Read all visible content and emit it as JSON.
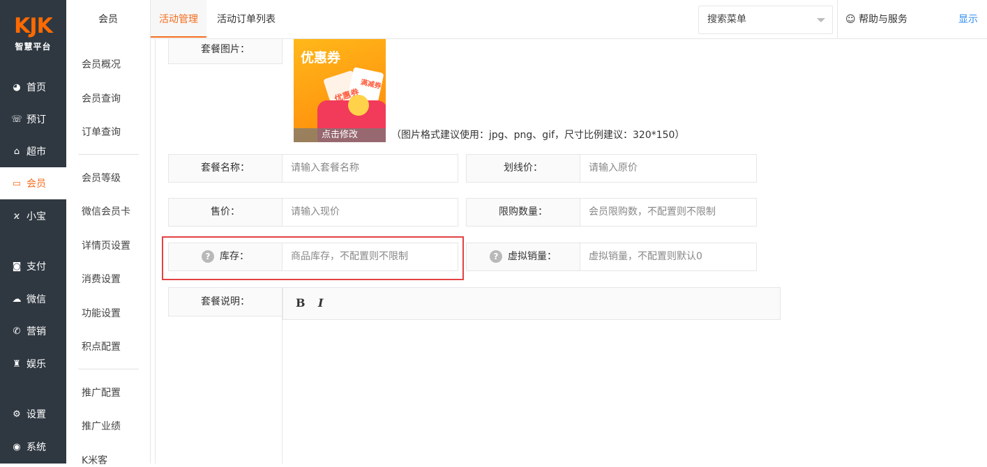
{
  "logo": {
    "mark": "KJK",
    "subtitle": "智慧平台"
  },
  "leftnav": [
    {
      "label": "首页",
      "icon": "dashboard-icon",
      "glyph": "◕"
    },
    {
      "label": "预订",
      "icon": "phone-icon",
      "glyph": "☏"
    },
    {
      "label": "超市",
      "icon": "basket-icon",
      "glyph": "⌂"
    },
    {
      "label": "会员",
      "icon": "card-icon",
      "glyph": "▭"
    },
    {
      "label": "小宝",
      "icon": "xiaobao-icon",
      "glyph": "ϰ"
    },
    {
      "label": "支付",
      "icon": "money-icon",
      "glyph": "◙"
    },
    {
      "label": "微信",
      "icon": "wechat-icon",
      "glyph": "☁"
    },
    {
      "label": "营销",
      "icon": "megaphone-icon",
      "glyph": "✆"
    },
    {
      "label": "娱乐",
      "icon": "game-icon",
      "glyph": "♜"
    },
    {
      "label": "设置",
      "icon": "gear-icon",
      "glyph": "⚙"
    },
    {
      "label": "系统",
      "icon": "chrome-icon",
      "glyph": "◉"
    }
  ],
  "subnav": {
    "head": "会员",
    "items": [
      "会员概况",
      "会员查询",
      "订单查询",
      "会员等级",
      "微信会员卡",
      "详情页设置",
      "消费设置",
      "功能设置",
      "积点配置",
      "推广配置",
      "推广业绩",
      "K米客"
    ]
  },
  "topbar": {
    "tabs": [
      "活动管理",
      "活动订单列表"
    ],
    "search_menu": "搜索菜单",
    "help": "帮助与服务",
    "show": "显示"
  },
  "form": {
    "image_label": "套餐图片：",
    "coupon_title": "优惠券",
    "coupon_card1": "优惠券",
    "coupon_card2": "满减券",
    "image_edit": "点击修改",
    "image_hint": "（图片格式建议使用：jpg、png、gif，尺寸比例建议：320*150）",
    "name_label": "套餐名称：",
    "name_placeholder": "请输入套餐名称",
    "original_price_label": "划线价：",
    "original_price_placeholder": "请输入原价",
    "price_label": "售价：",
    "price_placeholder": "请输入现价",
    "limit_label": "限购数量：",
    "limit_placeholder": "会员限购数，不配置则不限制",
    "stock_label": "库存：",
    "stock_placeholder": "商品库存，不配置则不限制",
    "virtual_sales_label": "虚拟销量：",
    "virtual_sales_placeholder": "虚拟销量，不配置则默认0",
    "desc_label": "套餐说明：",
    "bold": "B",
    "italic": "I"
  }
}
